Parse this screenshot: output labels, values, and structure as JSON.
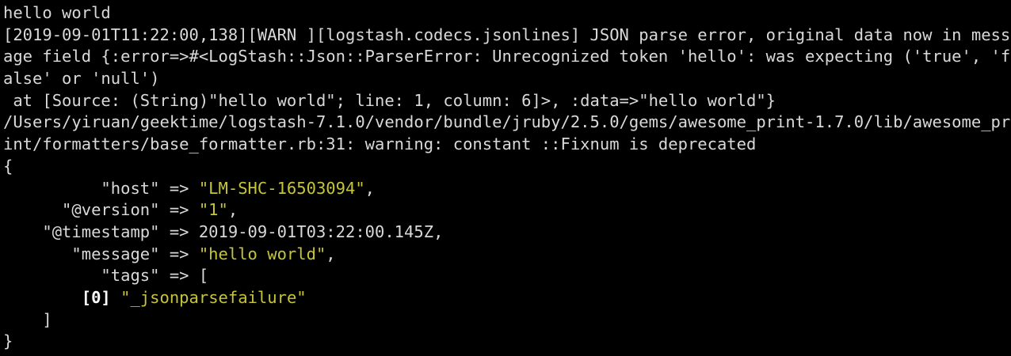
{
  "terminal": {
    "colors": {
      "background": "#000000",
      "text": "#d9d9d9",
      "string": "#c6c43b",
      "index": "#ffffff"
    },
    "lines": {
      "input": "hello world",
      "warn_1": "[2019-09-01T11:22:00,138][WARN ][logstash.codecs.jsonlines] JSON parse error, original data now in mess",
      "warn_2": "age field {:error=>#<LogStash::Json::ParserError: Unrecognized token 'hello': was expecting ('true', 'f",
      "warn_3": "alse' or 'null')",
      "warn_4": " at [Source: (String)\"hello world\"; line: 1, column: 6]>, :data=>\"hello world\"}",
      "deprecation_1": "/Users/yiruan/geektime/logstash-7.1.0/vendor/bundle/jruby/2.5.0/gems/awesome_print-1.7.0/lib/awesome_pr",
      "deprecation_2": "int/formatters/base_formatter.rb:31: warning: constant ::Fixnum is deprecated",
      "open_brace": "{",
      "close_brace": "}"
    },
    "event": {
      "host": {
        "key": "          \"host\" => ",
        "value": "\"LM-SHC-16503094\"",
        "suffix": ","
      },
      "version": {
        "key": "      \"@version\" => ",
        "value": "\"1\"",
        "suffix": ","
      },
      "timestamp": {
        "key": "    \"@timestamp\" => ",
        "value": "2019-09-01T03:22:00.145Z",
        "suffix": ","
      },
      "message": {
        "key": "       \"message\" => ",
        "value": "\"hello world\"",
        "suffix": ","
      },
      "tags": {
        "key": "          \"tags\" => ",
        "open": "[",
        "item_prefix": "        ",
        "item_index": "[0]",
        "item_value": "\"_jsonparsefailure\"",
        "close": "    ]"
      }
    }
  }
}
